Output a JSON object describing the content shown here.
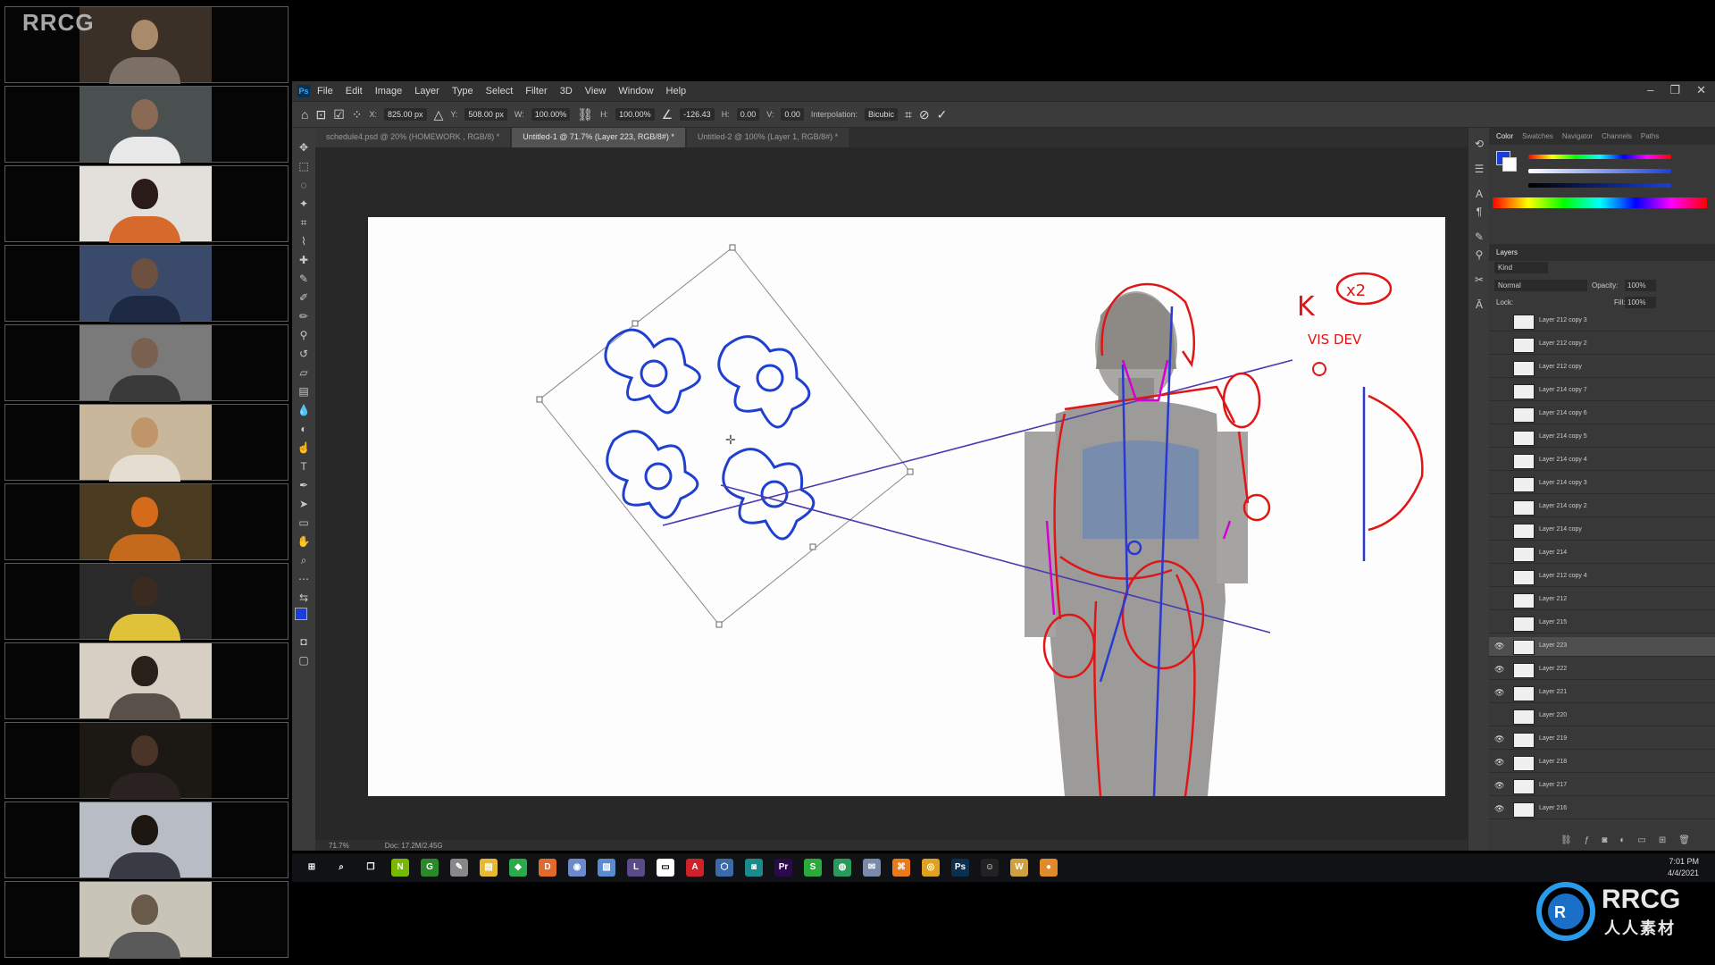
{
  "watermark": "RRCG",
  "participants": [
    {
      "name": "participant-1",
      "head": "#a98a6a",
      "bg": "#3a3028",
      "shirt": "#7c6f66"
    },
    {
      "name": "participant-2",
      "head": "#8a6a55",
      "bg": "#4a5050",
      "shirt": "#e8e8e8"
    },
    {
      "name": "participant-3",
      "head": "#2a1a18",
      "bg": "#e3e0dc",
      "shirt": "#d6692b"
    },
    {
      "name": "participant-4",
      "head": "#6e5040",
      "bg": "#3a4a6a",
      "shirt": "#1e2a44"
    },
    {
      "name": "participant-5",
      "head": "#7a6050",
      "bg": "#7a7a7a",
      "shirt": "#3a3a3a"
    },
    {
      "name": "participant-6",
      "head": "#c0956a",
      "bg": "#c8b79a",
      "shirt": "#e4ded2"
    },
    {
      "name": "participant-7",
      "head": "#d46a1a",
      "bg": "#4a3a20",
      "shirt": "#c46a1c"
    },
    {
      "name": "participant-8",
      "head": "#3a2a20",
      "bg": "#2a2a2a",
      "shirt": "#e0c23a"
    },
    {
      "name": "participant-9",
      "head": "#2a201a",
      "bg": "#d8cfc4",
      "shirt": "#5a504a"
    },
    {
      "name": "participant-10",
      "head": "#4a3428",
      "bg": "#1c1814",
      "shirt": "#2a2220"
    },
    {
      "name": "participant-11",
      "head": "#1e1610",
      "bg": "#b8bcc4",
      "shirt": "#3a3a44"
    },
    {
      "name": "participant-12",
      "head": "#6a5a4a",
      "bg": "#c8c4b8",
      "shirt": "#5a5a5a"
    }
  ],
  "menubar": {
    "items": [
      "File",
      "Edit",
      "Image",
      "Layer",
      "Type",
      "Select",
      "Filter",
      "3D",
      "View",
      "Window",
      "Help"
    ],
    "logo": "Ps"
  },
  "options": {
    "x_label": "X:",
    "x_value": "825.00 px",
    "y_label": "Y:",
    "y_value": "508.00 px",
    "w_label": "W:",
    "w_value": "100.00%",
    "h_label": "H:",
    "h_value": "100.00%",
    "angle_value": "-126.43",
    "hskew_label": "H:",
    "hskew_value": "0.00",
    "vskew_label": "V:",
    "vskew_value": "0.00",
    "interp_label": "Interpolation:",
    "interp_value": "Bicubic"
  },
  "tabs": [
    {
      "label": "schedule4.psd @ 20% (HOMEWORK , RGB/8) *",
      "active": false
    },
    {
      "label": "Untitled-1 @ 71.7% (Layer 223, RGB/8#) *",
      "active": true
    },
    {
      "label": "Untitled-2 @ 100% (Layer 1, RGB/8#) *",
      "active": false
    }
  ],
  "status": {
    "zoom": "71.7%",
    "doc": "Doc: 17.2M/2.45G"
  },
  "canvas_text": {
    "k_note": "K",
    "x2_note": "x2",
    "visdev_note": "VIS DEV"
  },
  "panels": {
    "color_tabs": [
      "Color",
      "Swatches",
      "Navigator",
      "Channels",
      "Paths"
    ],
    "color_active": "Color",
    "layers_title": "Layers",
    "kind_label": "Kind",
    "blend_mode": "Normal",
    "opacity_label": "Opacity:",
    "opacity_value": "100%",
    "lock_label": "Lock:",
    "fill_label": "Fill:",
    "fill_value": "100%",
    "fg_color": "#1a3fd8",
    "bg_color": "#ffffff"
  },
  "layers": [
    {
      "name": "Layer 212 copy 3",
      "visible": false,
      "selected": false
    },
    {
      "name": "Layer 212 copy 2",
      "visible": false,
      "selected": false
    },
    {
      "name": "Layer 212 copy",
      "visible": false,
      "selected": false
    },
    {
      "name": "Layer 214 copy 7",
      "visible": false,
      "selected": false
    },
    {
      "name": "Layer 214 copy 6",
      "visible": false,
      "selected": false
    },
    {
      "name": "Layer 214 copy 5",
      "visible": false,
      "selected": false
    },
    {
      "name": "Layer 214 copy 4",
      "visible": false,
      "selected": false
    },
    {
      "name": "Layer 214 copy 3",
      "visible": false,
      "selected": false
    },
    {
      "name": "Layer 214 copy 2",
      "visible": false,
      "selected": false
    },
    {
      "name": "Layer 214 copy",
      "visible": false,
      "selected": false
    },
    {
      "name": "Layer 214",
      "visible": false,
      "selected": false
    },
    {
      "name": "Layer 212 copy 4",
      "visible": false,
      "selected": false
    },
    {
      "name": "Layer 212",
      "visible": false,
      "selected": false
    },
    {
      "name": "Layer 215",
      "visible": false,
      "selected": false
    },
    {
      "name": "Layer 223",
      "visible": true,
      "selected": true
    },
    {
      "name": "Layer 222",
      "visible": true,
      "selected": false
    },
    {
      "name": "Layer 221",
      "visible": true,
      "selected": false
    },
    {
      "name": "Layer 220",
      "visible": false,
      "selected": false
    },
    {
      "name": "Layer 219",
      "visible": true,
      "selected": false
    },
    {
      "name": "Layer 218",
      "visible": true,
      "selected": false
    },
    {
      "name": "Layer 217",
      "visible": true,
      "selected": false
    },
    {
      "name": "Layer 216",
      "visible": true,
      "selected": false
    }
  ],
  "taskbar": {
    "apps": [
      {
        "name": "windows-start-icon",
        "color": "#ffffff",
        "glyph": "⊞"
      },
      {
        "name": "search-icon",
        "color": "#ffffff",
        "glyph": "⌕"
      },
      {
        "name": "task-view-icon",
        "color": "#ffffff",
        "glyph": "❐"
      },
      {
        "name": "nvidia-icon",
        "color": "#76b900",
        "glyph": "N"
      },
      {
        "name": "geforce-icon",
        "color": "#2a8a2a",
        "glyph": "G"
      },
      {
        "name": "pen-tool-app-icon",
        "color": "#888888",
        "glyph": "✎"
      },
      {
        "name": "file-explorer-icon",
        "color": "#e8b830",
        "glyph": "▤"
      },
      {
        "name": "sketchbook-icon",
        "color": "#2aaa4a",
        "glyph": "◆"
      },
      {
        "name": "discord-icon",
        "color": "#e06a2a",
        "glyph": "D"
      },
      {
        "name": "blender-like-icon",
        "color": "#6a8acc",
        "glyph": "◉"
      },
      {
        "name": "notes-app-icon",
        "color": "#5a8ad0",
        "glyph": "▨"
      },
      {
        "name": "live-app-icon",
        "color": "#5a4a8a",
        "glyph": "L"
      },
      {
        "name": "zoom-icon",
        "color": "#ffffff",
        "glyph": "▭"
      },
      {
        "name": "acrobat-icon",
        "color": "#d0202a",
        "glyph": "A"
      },
      {
        "name": "cube-app-icon",
        "color": "#3a6aaa",
        "glyph": "⬡"
      },
      {
        "name": "game-app-icon",
        "color": "#1a8a8a",
        "glyph": "◙"
      },
      {
        "name": "premiere-icon",
        "color": "#2a0a4a",
        "glyph": "Pr"
      },
      {
        "name": "s-app-icon",
        "color": "#2aaa3a",
        "glyph": "S"
      },
      {
        "name": "globe-app-icon",
        "color": "#2a9a5a",
        "glyph": "◍"
      },
      {
        "name": "mail-app-icon",
        "color": "#7a8aa8",
        "glyph": "✉"
      },
      {
        "name": "blender-icon",
        "color": "#e87a1a",
        "glyph": "⌘"
      },
      {
        "name": "chrome-icon",
        "color": "#e0a020",
        "glyph": "◎"
      },
      {
        "name": "photoshop-icon",
        "color": "#0b2f4f",
        "glyph": "Ps"
      },
      {
        "name": "cat-app-icon",
        "color": "#222222",
        "glyph": "☺"
      },
      {
        "name": "w-app-icon",
        "color": "#d0a040",
        "glyph": "W"
      },
      {
        "name": "orange-app-icon",
        "color": "#e08a2a",
        "glyph": "●"
      }
    ],
    "time": "7:01 PM",
    "date": "4/4/2021"
  },
  "logo": {
    "big": "RRCG",
    "small": "人人素材"
  }
}
